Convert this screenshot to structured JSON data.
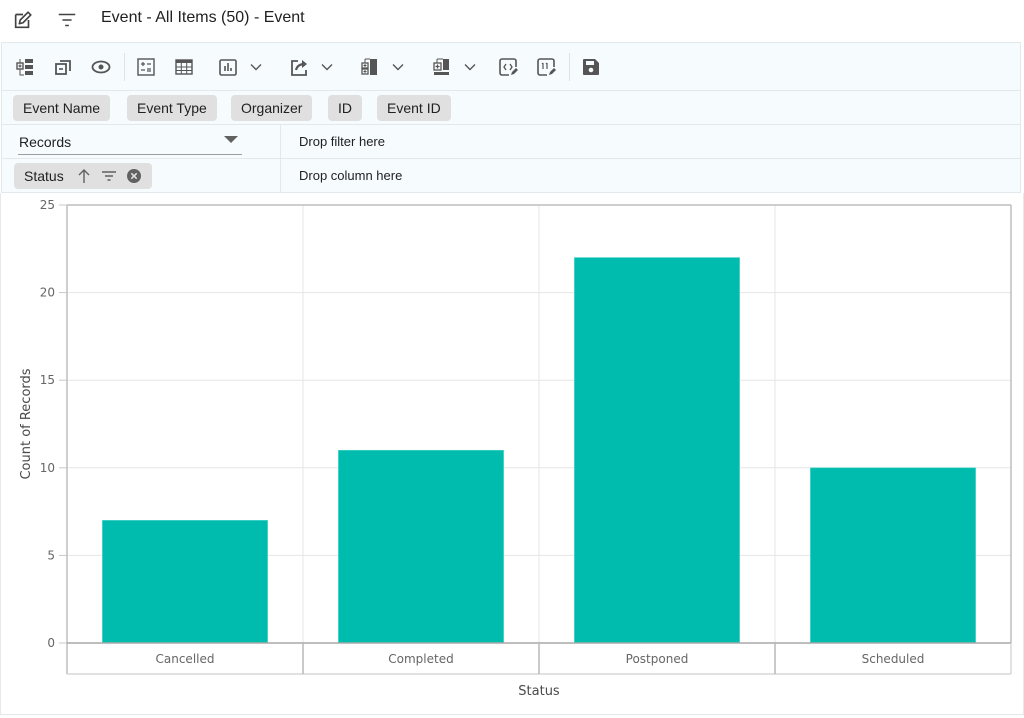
{
  "header": {
    "title": "Event - All Items (50) - Event",
    "icons": [
      "edit-icon",
      "filter-icon"
    ]
  },
  "toolbar": {
    "buttons": [
      {
        "name": "field-list-button",
        "icon": "field-list-icon"
      },
      {
        "name": "collapse-button",
        "icon": "collapse-icon"
      },
      {
        "name": "preview-button",
        "icon": "eye-icon"
      },
      {
        "name": "calculated-field-button",
        "icon": "calculator-icon"
      },
      {
        "name": "grid-view-button",
        "icon": "table-icon"
      },
      {
        "name": "chart-type-button",
        "icon": "bar-chart-icon",
        "dropdown": true
      },
      {
        "name": "export-button",
        "icon": "export-icon",
        "dropdown": true
      },
      {
        "name": "subtotals-button",
        "icon": "subtotals-icon",
        "dropdown": true
      },
      {
        "name": "grand-totals-button",
        "icon": "grand-totals-icon",
        "dropdown": true
      },
      {
        "name": "conditional-format-button",
        "icon": "code-edit-icon"
      },
      {
        "name": "number-format-button",
        "icon": "number-format-icon"
      },
      {
        "name": "save-button",
        "icon": "save-icon"
      }
    ]
  },
  "fields": [
    "Event Name",
    "Event Type",
    "Organizer",
    "ID",
    "Event ID"
  ],
  "values_row": {
    "selected": "Records",
    "filter_placeholder": "Drop filter here"
  },
  "columns_row": {
    "chip_label": "Status",
    "chip_icons": [
      "sort-ascending-icon",
      "filter-icon",
      "remove-icon"
    ],
    "column_placeholder": "Drop column here"
  },
  "colors": {
    "bar": "#00bcae",
    "panel_bg": "#f6fbfe",
    "chip_bg": "#e0e0e0"
  },
  "chart_data": {
    "type": "bar",
    "title": "",
    "xlabel": "Status",
    "ylabel": "Count of Records",
    "categories": [
      "Cancelled",
      "Completed",
      "Postponed",
      "Scheduled"
    ],
    "values": [
      7,
      11,
      22,
      10
    ],
    "ylim": [
      0,
      25
    ],
    "yticks": [
      0,
      5,
      10,
      15,
      20,
      25
    ],
    "grid": true,
    "legend": "none"
  }
}
